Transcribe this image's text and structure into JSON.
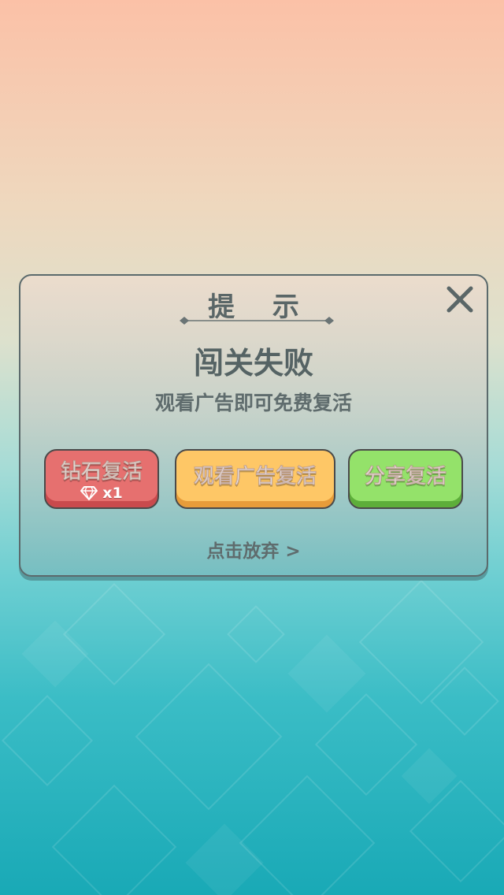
{
  "dialog": {
    "title": "提 示",
    "heading": "闯关失败",
    "subheading": "观看广告即可免费复活",
    "buttons": {
      "diamond_label": "钻石复活",
      "diamond_cost": "x1",
      "ad_label": "观看广告复活",
      "share_label": "分享复活"
    },
    "give_up": "点击放弃 >"
  },
  "colors": {
    "diamond_button": "#e6706f",
    "ad_button": "#fec766",
    "share_button": "#94e26a",
    "text": "#5a6667"
  },
  "icons": {
    "close": "close-icon",
    "gem": "gem-icon"
  }
}
